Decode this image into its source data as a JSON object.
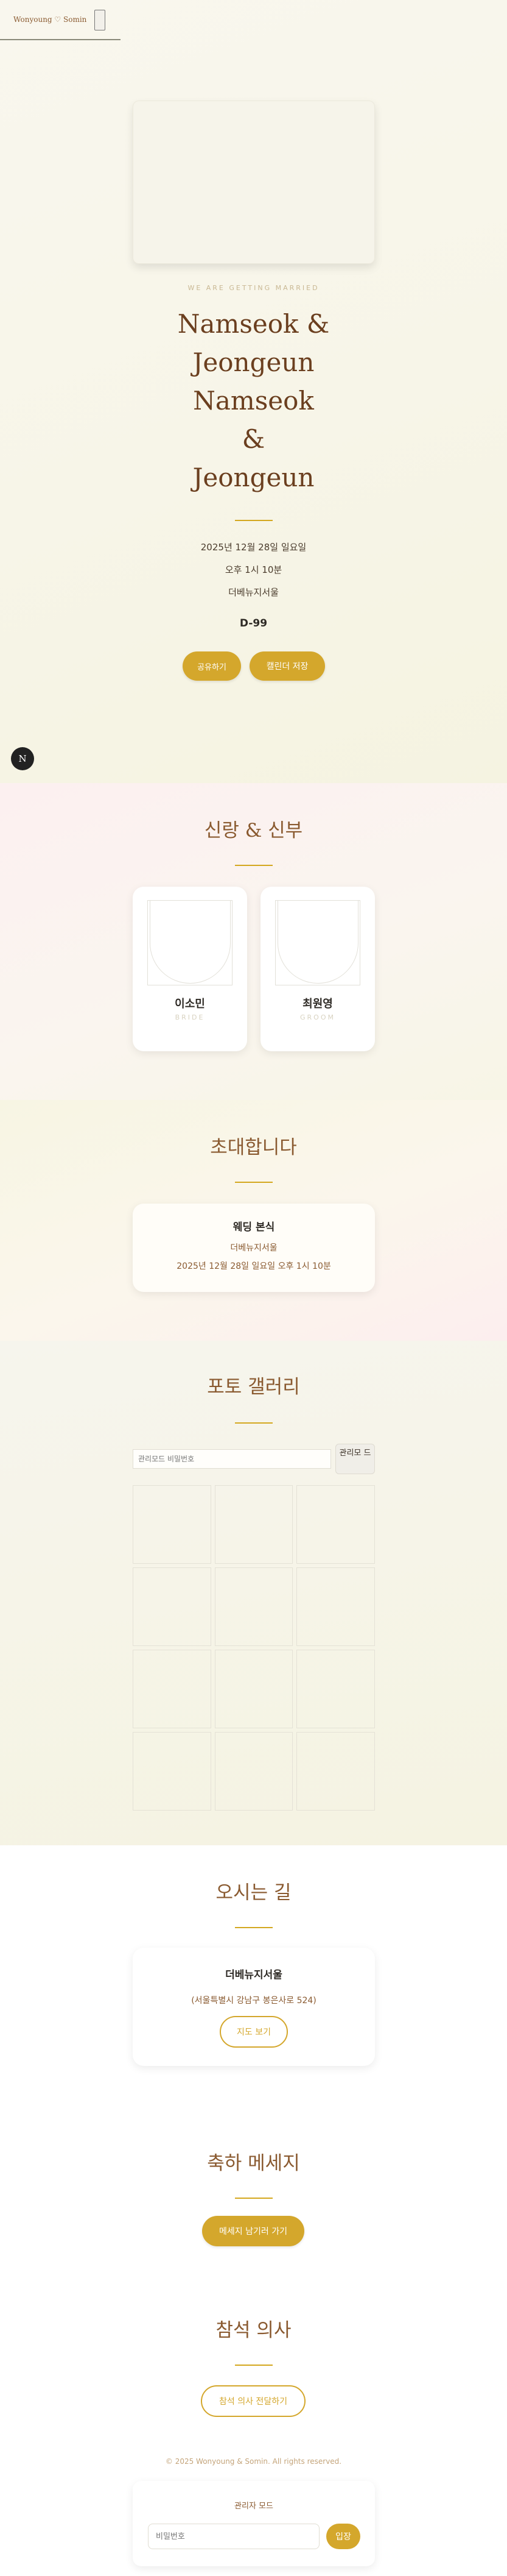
{
  "header": {
    "brand": "Wonyoung ♡ Somin"
  },
  "hero": {
    "tagline": "WE ARE GETTING MARRIED",
    "names": [
      "Namseok &",
      "Jeongeun",
      "Namseok",
      "&",
      "Jeongeun"
    ],
    "date": "2025년 12월 28일 일요일",
    "time": "오후 1시 10분",
    "venue": "더베뉴지서울",
    "dday": "D-99",
    "share_label": "공유하기",
    "calendar_label": "캘린더 저장"
  },
  "fab": {
    "label": "N"
  },
  "couple": {
    "title": "신랑 & 신부",
    "bride": {
      "name": "이소민",
      "role": "BRIDE"
    },
    "groom": {
      "name": "최원영",
      "role": "GROOM"
    }
  },
  "invitation": {
    "title": "초대합니다",
    "card_heading": "웨딩 본식",
    "venue": "더베뉴지서울",
    "datetime": "2025년 12월 28일 일요일 오후 1시 10분"
  },
  "gallery": {
    "title": "포토 갤러리",
    "admin_password_placeholder": "관리모드 비밀번호",
    "admin_mode_label": "관리모 드"
  },
  "directions": {
    "title": "오시는 길",
    "venue": "더베뉴지서울",
    "address": "(서울특별시 강남구 봉은사로 524)",
    "map_label": "지도 보기"
  },
  "messages": {
    "title": "축하 메세지",
    "leave_label": "메세지 남기러 가기"
  },
  "rsvp": {
    "title": "참석 의사",
    "send_label": "참석 의사 전달하기"
  },
  "footer": {
    "copyright": "© 2025 Wonyoung & Somin. All rights reserved."
  },
  "admin": {
    "title": "관리자 모드",
    "password_placeholder": "비밀번호",
    "enter_label": "입장"
  },
  "colors": {
    "accent": "#d4a72c",
    "heading": "#8a5a30"
  }
}
